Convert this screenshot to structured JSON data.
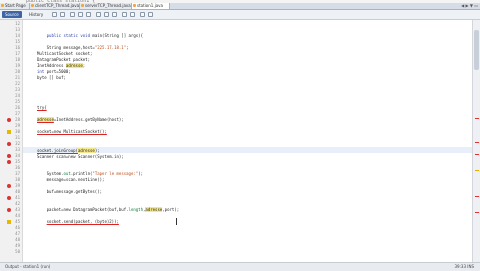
{
  "top_code_fragment": "public class station1 {",
  "tabs": [
    {
      "label": "Start Page"
    },
    {
      "label": "clientTCP_Thread.java"
    },
    {
      "label": "serverTCP_Thread.java"
    },
    {
      "label": "station1.java"
    }
  ],
  "toolbar": {
    "source_label": "Source",
    "history_label": "History"
  },
  "line_numbers": [
    "12",
    "13",
    "14",
    "15",
    "16",
    "17",
    "18",
    "19",
    "20",
    "21",
    "22",
    "23",
    "24",
    "25",
    "26",
    "27",
    "28",
    "29",
    "30",
    "31",
    "32",
    "33",
    "34",
    "35",
    "36",
    "37",
    "38",
    "39",
    "40",
    "41",
    "42",
    "43",
    "44",
    "45",
    "46",
    "47",
    "48",
    "49",
    "50"
  ],
  "code": {
    "l13_kw": "public static void ",
    "l13_rest": "main(String [] args){",
    "l15_a": "String message,host=",
    "l15_str": "\"225.17.18.1\"",
    "l15_b": ";",
    "l16": "MulticastSocket socket;",
    "l17": "DatagramPacket packet;",
    "l18_a": "InetAddress ",
    "l18_b": "adresse",
    "l18_c": ";",
    "l19_kw": "int ",
    "l19_rest": "port=5000;",
    "l20": "byte [] buf;",
    "l23": "try{",
    "l24_a": "adresse",
    "l24_b": "=InetAddress.getByName(host);",
    "l26": "socket=new MulticastSocket();",
    "l28_a": "socket.joinGroup(",
    "l28_b": "adresse",
    "l28_c": ");",
    "l29": "Scanner scan=new Scanner(System.in);",
    "l31_a": "System.",
    "l31_b": "out",
    "l31_c": ".println(",
    "l31_str": "\"Taper le message:\"",
    "l31_d": ");",
    "l32": "message=scan.nextLine();",
    "l34": "buf=message.getBytes();",
    "l36_a": "packet=new DatagramPacket(buf,buf.",
    "l36_b": "length",
    "l36_c": ",",
    "l36_d": "adresse",
    "l36_e": ",port);",
    "l38_a": "socket.send(packet, (byte)2));"
  },
  "statusbar": {
    "text": "Output - station1 (run)",
    "position": "39:33",
    "mode": "INS"
  }
}
